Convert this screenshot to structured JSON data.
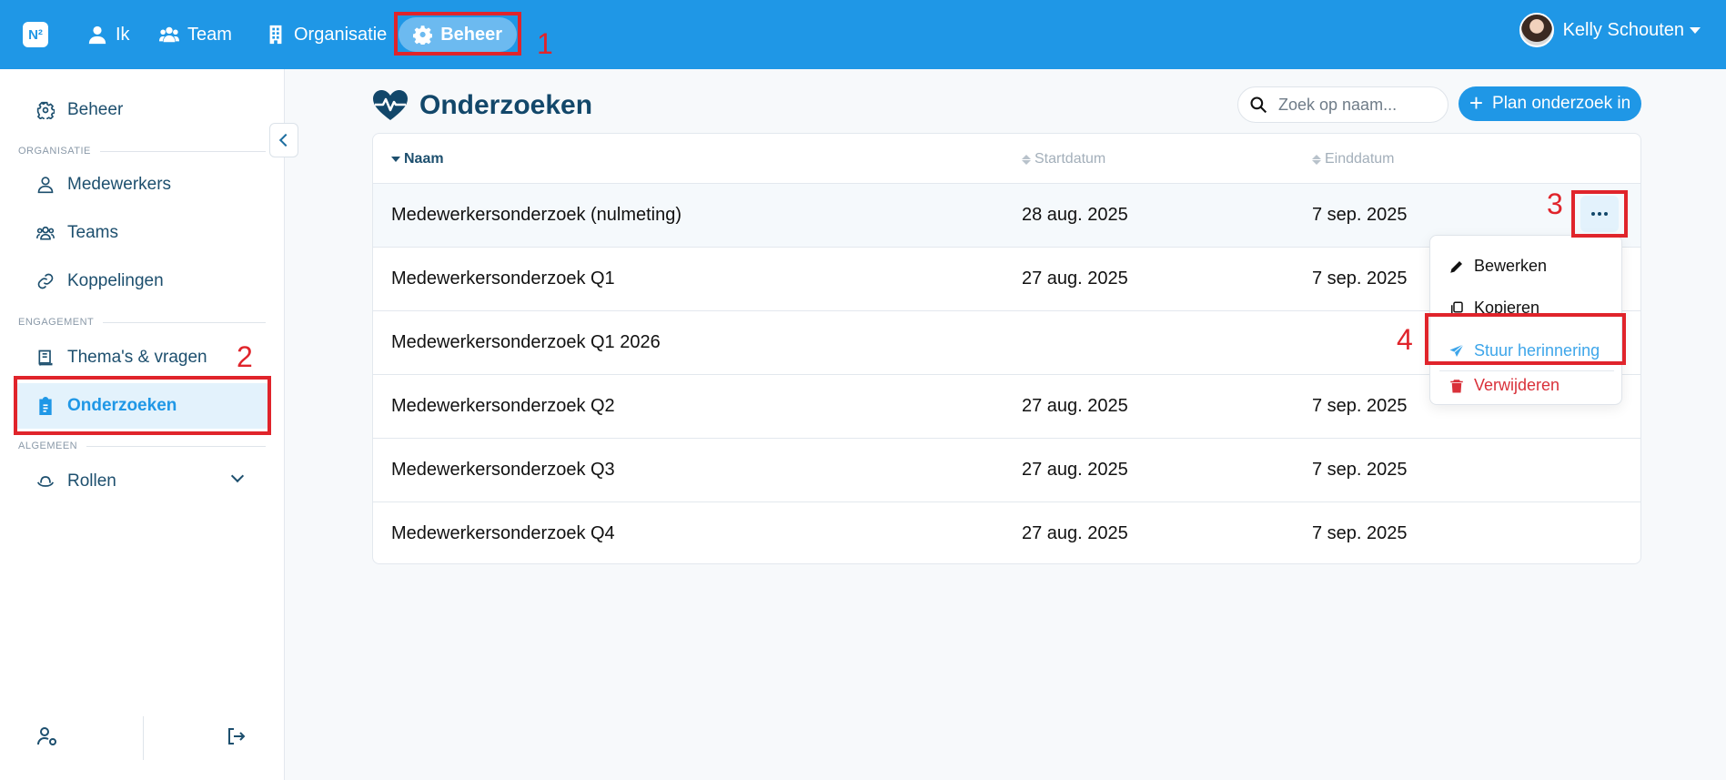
{
  "app": {
    "logo_text": "N²"
  },
  "topnav": {
    "items": [
      {
        "label": "Ik",
        "icon": "user-icon"
      },
      {
        "label": "Team",
        "icon": "users-icon"
      },
      {
        "label": "Organisatie",
        "icon": "building-icon"
      },
      {
        "label": "Beheer",
        "icon": "gear-icon",
        "active": true
      }
    ],
    "user_name": "Kelly Schouten"
  },
  "sidebar": {
    "top_item": {
      "label": "Beheer",
      "icon": "gear-icon"
    },
    "sections": [
      {
        "label": "ORGANISATIE",
        "items": [
          {
            "label": "Medewerkers",
            "icon": "user-icon"
          },
          {
            "label": "Teams",
            "icon": "users-icon"
          },
          {
            "label": "Koppelingen",
            "icon": "link-icon"
          }
        ]
      },
      {
        "label": "ENGAGEMENT",
        "items": [
          {
            "label": "Thema's & vragen",
            "icon": "book-icon"
          },
          {
            "label": "Onderzoeken",
            "icon": "clipboard-icon",
            "active": true
          }
        ]
      },
      {
        "label": "ALGEMEEN",
        "items": [
          {
            "label": "Rollen",
            "icon": "hat-icon",
            "expandable": true
          }
        ]
      }
    ]
  },
  "main": {
    "title": "Onderzoeken",
    "search_placeholder": "Zoek op naam...",
    "plan_button": "Plan onderzoek in",
    "columns": [
      "Naam",
      "Startdatum",
      "Einddatum"
    ],
    "rows": [
      {
        "name": "Medewerkersonderzoek (nulmeting)",
        "start": "28 aug. 2025",
        "end": "7 sep. 2025"
      },
      {
        "name": "Medewerkersonderzoek Q1",
        "start": "27 aug. 2025",
        "end": "7 sep. 2025"
      },
      {
        "name": "Medewerkersonderzoek Q1 2026",
        "start": "",
        "end": ""
      },
      {
        "name": "Medewerkersonderzoek Q2",
        "start": "27 aug. 2025",
        "end": "7 sep. 2025"
      },
      {
        "name": "Medewerkersonderzoek Q3",
        "start": "27 aug. 2025",
        "end": "7 sep. 2025"
      },
      {
        "name": "Medewerkersonderzoek Q4",
        "start": "27 aug. 2025",
        "end": "7 sep. 2025"
      }
    ],
    "row_menu": {
      "edit": "Bewerken",
      "copy": "Kopieren",
      "reminder": "Stuur herinnering",
      "delete": "Verwijderen"
    }
  },
  "annotations": [
    "1",
    "2",
    "3",
    "4"
  ],
  "colors": {
    "primary": "#1f97e6",
    "navy": "#12476a",
    "danger": "#d9313a",
    "annotation": "#e0242b"
  }
}
